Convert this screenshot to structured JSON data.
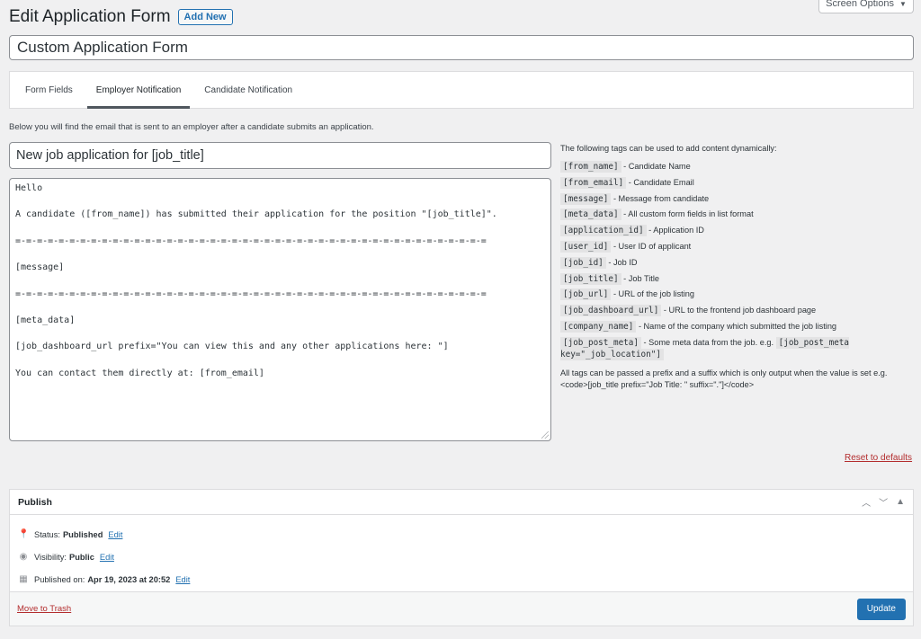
{
  "screen_options": {
    "label": "Screen Options",
    "caret": "▼"
  },
  "header": {
    "title": "Edit Application Form",
    "add_new_label": "Add New"
  },
  "form_title": {
    "value": "Custom Application Form"
  },
  "tabs": [
    {
      "label": "Form Fields",
      "active": false
    },
    {
      "label": "Employer Notification",
      "active": true
    },
    {
      "label": "Candidate Notification",
      "active": false
    }
  ],
  "description": "Below you will find the email that is sent to an employer after a candidate submits an application.",
  "email": {
    "subject": "New job application for [job_title]",
    "body_lines": [
      "Hello",
      "",
      "A candidate ([from_name]) has submitted their application for the position \"[job_title]\".",
      "",
      "=-=-=-=-=-=-=-=-=-=-=-=-=-=-=-=-=-=-=-=-=-=-=-=-=-=-=-=-=-=-=-=-=-=-=-=-=-=-=-=-=-=-=-=",
      "",
      "[message]",
      "",
      "=-=-=-=-=-=-=-=-=-=-=-=-=-=-=-=-=-=-=-=-=-=-=-=-=-=-=-=-=-=-=-=-=-=-=-=-=-=-=-=-=-=-=-=",
      "",
      "[meta_data]",
      "",
      "[job_dashboard_url prefix=\"You can view this and any other applications here: \"]",
      "",
      "You can contact them directly at: [from_email]"
    ]
  },
  "tags_panel": {
    "intro": "The following tags can be used to add content dynamically:",
    "tags": [
      {
        "code": "[from_name]",
        "desc": "- Candidate Name"
      },
      {
        "code": "[from_email]",
        "desc": "- Candidate Email"
      },
      {
        "code": "[message]",
        "desc": "- Message from candidate"
      },
      {
        "code": "[meta_data]",
        "desc": "- All custom form fields in list format"
      },
      {
        "code": "[application_id]",
        "desc": "- Application ID"
      },
      {
        "code": "[user_id]",
        "desc": "- User ID of applicant"
      },
      {
        "code": "[job_id]",
        "desc": "- Job ID"
      },
      {
        "code": "[job_title]",
        "desc": "- Job Title"
      },
      {
        "code": "[job_url]",
        "desc": "- URL of the job listing"
      },
      {
        "code": "[job_dashboard_url]",
        "desc": "- URL to the frontend job dashboard page"
      },
      {
        "code": "[company_name]",
        "desc": "- Name of the company which submitted the job listing"
      },
      {
        "code": "[job_post_meta]",
        "desc": "- Some meta data from the job. e.g.",
        "example": "[job_post_meta key=\"_job_location\"]"
      }
    ],
    "note": "All tags can be passed a prefix and a suffix which is only output when the value is set e.g. <code>[job_title prefix=\"Job Title: \" suffix=\".\"]</code>"
  },
  "reset_label": "Reset to defaults",
  "publish": {
    "title": "Publish",
    "status_label": "Status:",
    "status_value": "Published",
    "visibility_label": "Visibility:",
    "visibility_value": "Public",
    "published_on_label": "Published on:",
    "published_on_value": "Apr 19, 2023 at 20:52",
    "edit_label": "Edit",
    "trash_label": "Move to Trash",
    "update_label": "Update"
  }
}
